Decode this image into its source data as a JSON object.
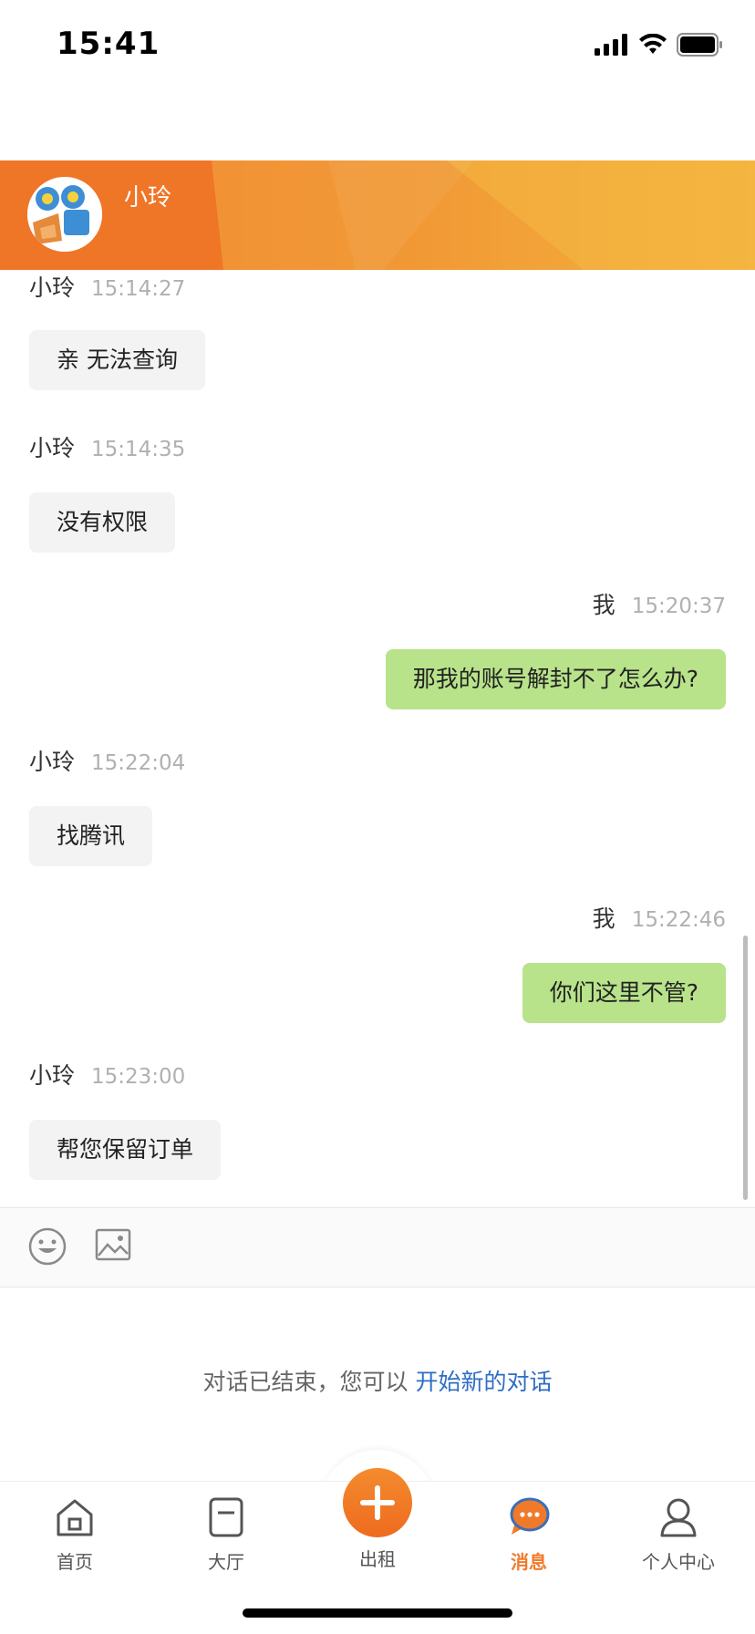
{
  "status_bar": {
    "time": "15:41"
  },
  "header": {
    "contact_name": "小玲"
  },
  "messages": [
    {
      "sender": "小玲",
      "time": "15:14:27",
      "text": "亲 无法查询",
      "side": "in"
    },
    {
      "sender": "小玲",
      "time": "15:14:35",
      "text": "没有权限",
      "side": "in"
    },
    {
      "sender": "我",
      "time": "15:20:37",
      "text": "那我的账号解封不了怎么办?",
      "side": "out"
    },
    {
      "sender": "小玲",
      "time": "15:22:04",
      "text": "找腾讯",
      "side": "in"
    },
    {
      "sender": "我",
      "time": "15:22:46",
      "text": "你们这里不管?",
      "side": "out"
    },
    {
      "sender": "小玲",
      "time": "15:23:00",
      "text": "帮您保留订单",
      "side": "in"
    }
  ],
  "toolbar": {
    "emoji_icon": "emoji-icon",
    "image_icon": "image-icon"
  },
  "ended_notice": {
    "text": "对话已结束，您可以 ",
    "link": "开始新的对话"
  },
  "tabs": [
    {
      "label": "首页",
      "icon": "home-icon"
    },
    {
      "label": "大厅",
      "icon": "hall-icon"
    },
    {
      "label": "出租",
      "icon": "plus-icon"
    },
    {
      "label": "消息",
      "icon": "message-icon",
      "active": true
    },
    {
      "label": "个人中心",
      "icon": "user-icon"
    }
  ],
  "colors": {
    "accent": "#f07a2a",
    "outgoing_bubble": "#b8e38a",
    "incoming_bubble": "#f3f3f3",
    "link": "#2f6ec4"
  }
}
